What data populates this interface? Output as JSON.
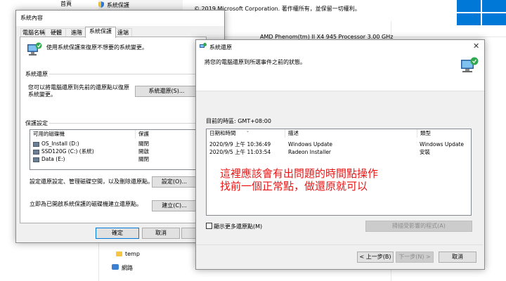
{
  "background": {
    "copyright": "© 2019 Microsoft Corporation. 著作權所有，並保留一切權利。",
    "processor": "AMD Phenom(tm) II X4 945 Processor   3.00 GHz",
    "breadcrumb_home": "首頁",
    "breadcrumb_sysprot": "系統保護",
    "explorer_items": [
      "temp",
      "網路"
    ],
    "win_blue": "#0078d7"
  },
  "sysprop": {
    "title": "系統內容",
    "tabs": [
      "電腦名稱",
      "硬體",
      "進階",
      "系統保護",
      "遠端"
    ],
    "intro": "使用系統保護來復原不想要的系統變更。",
    "restore_section": "系統還原",
    "restore_desc": "您可以將電腦還原到先前的還原點以復原系統變更。",
    "restore_button": "系統還原(S)...",
    "protection_section": "保護設定",
    "drives_headers": [
      "可用的磁碟機",
      "保護"
    ],
    "drives": [
      {
        "name": "OS_Install (D:)",
        "status": "關閉"
      },
      {
        "name": "SSD120G (C:) (系統)",
        "status": "開啟"
      },
      {
        "name": "Data (E:)",
        "status": "關閉"
      }
    ],
    "config_desc": "設定還原設定、管理磁碟空間，以及刪除還原點。",
    "config_button": "設定(O)...",
    "create_desc": "立即為已開啟系統保護的磁碟機建立還原點。",
    "create_button": "建立(C)...",
    "ok_button": "確定",
    "cancel_button": "取消"
  },
  "restore": {
    "title": "系統還原",
    "heading": "將您的電腦還原到所選事件之前的狀態。",
    "timezone": "目前的時區: GMT+08:00",
    "headers": [
      "日期和時間",
      "描述",
      "類型"
    ],
    "rows": [
      {
        "date": "2020/9/9 上午 10:36:49",
        "desc": "Windows Update",
        "type": "Windows Update"
      },
      {
        "date": "2020/9/5 上午 11:03:54",
        "desc": "Radeon Installer",
        "type": "安裝"
      }
    ],
    "annotation_line1": "這裡應該會有出問題的時間點操作",
    "annotation_line2": "找前一個正常點，做還原就可以",
    "annotation_color": "#e81616",
    "show_more": "顯示更多還原點(M)",
    "scan_button": "掃描受影響的程式(A)",
    "back_button": "< 上一步(B)",
    "next_button": "下一步(N) >",
    "cancel_button": "取消"
  }
}
